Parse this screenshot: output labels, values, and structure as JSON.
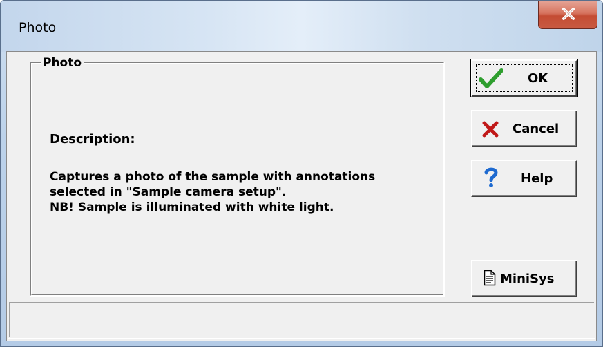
{
  "window": {
    "title": "Photo"
  },
  "group": {
    "title": "Photo",
    "description_heading": "Description:",
    "description_lines": [
      "Captures a photo of the sample with annotations",
      "selected in \"Sample camera setup\".",
      "NB!  Sample is illuminated with white light."
    ]
  },
  "buttons": {
    "ok": "OK",
    "cancel": "Cancel",
    "help": "Help",
    "minisys": "MiniSys"
  },
  "status": {
    "text": ""
  },
  "colors": {
    "ok_check": "#2e9e2e",
    "cancel_x": "#c01818",
    "help_q": "#1e6ad0",
    "close_bg": "#c44c33"
  },
  "icons": {
    "close": "close-icon",
    "ok": "checkmark-icon",
    "cancel": "x-mark-icon",
    "help": "question-mark-icon",
    "minisys": "document-icon"
  }
}
